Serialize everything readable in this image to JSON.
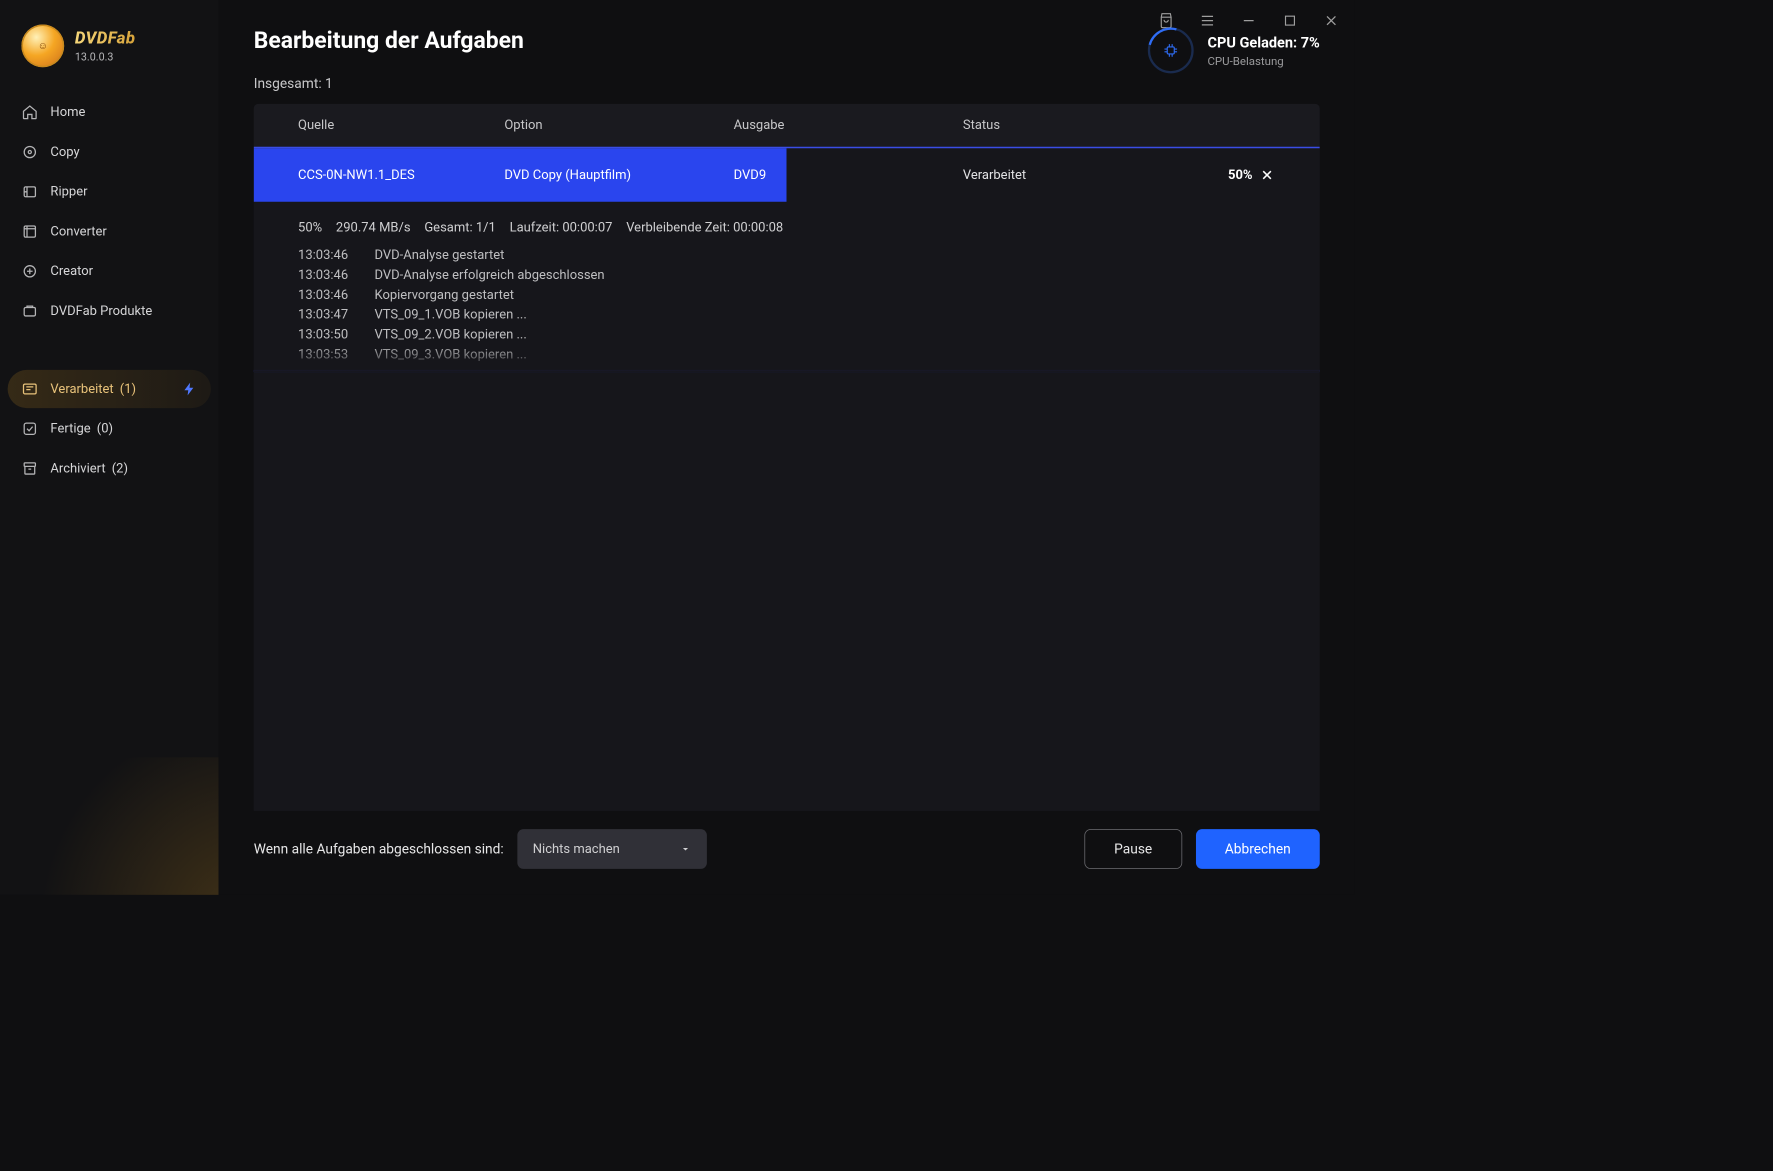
{
  "app": {
    "name": "DVDFab",
    "version": "13.0.0.3"
  },
  "sidebar": {
    "items": [
      {
        "id": "home",
        "label": "Home",
        "icon": "home-icon"
      },
      {
        "id": "copy",
        "label": "Copy",
        "icon": "copy-icon"
      },
      {
        "id": "ripper",
        "label": "Ripper",
        "icon": "ripper-icon"
      },
      {
        "id": "converter",
        "label": "Converter",
        "icon": "converter-icon"
      },
      {
        "id": "creator",
        "label": "Creator",
        "icon": "creator-icon"
      },
      {
        "id": "products",
        "label": "DVDFab Produkte",
        "icon": "products-icon"
      }
    ],
    "queue": [
      {
        "id": "processing",
        "label": "Verarbeitet",
        "count": "(1)",
        "active": true,
        "icon": "queue-icon",
        "bolt": true
      },
      {
        "id": "done",
        "label": "Fertige",
        "count": "(0)",
        "icon": "check-icon"
      },
      {
        "id": "archived",
        "label": "Archiviert",
        "count": "(2)",
        "icon": "archive-icon"
      }
    ]
  },
  "window_controls": {
    "shop": "Shop",
    "menu": "Menu",
    "min": "Minimize",
    "max": "Maximize",
    "close": "Close"
  },
  "header": {
    "title": "Bearbeitung der Aufgaben",
    "total_label": "Insgesamt: 1",
    "cpu_label": "CPU Geladen: 7%",
    "cpu_sub": "CPU-Belastung",
    "cpu_percent": 7
  },
  "columns": {
    "source": "Quelle",
    "option": "Option",
    "output": "Ausgabe",
    "status": "Status"
  },
  "task": {
    "source": "CCS-0N-NW1.1_DES",
    "option": "DVD Copy (Hauptfilm)",
    "output": "DVD9",
    "status": "Verarbeitet",
    "percent_label": "50%"
  },
  "stats": {
    "percent": "50%",
    "speed": "290.74 MB/s",
    "total": "Gesamt: 1/1",
    "runtime": "Laufzeit: 00:00:07",
    "remaining": "Verbleibende Zeit: 00:00:08"
  },
  "log": [
    {
      "time": "13:03:46",
      "msg": "DVD-Analyse gestartet"
    },
    {
      "time": "13:03:46",
      "msg": "DVD-Analyse erfolgreich abgeschlossen"
    },
    {
      "time": "13:03:46",
      "msg": "Kopiervorgang gestartet"
    },
    {
      "time": "13:03:47",
      "msg": "VTS_09_1.VOB kopieren ..."
    },
    {
      "time": "13:03:50",
      "msg": "VTS_09_2.VOB kopieren ..."
    },
    {
      "time": "13:03:53",
      "msg": "VTS_09_3.VOB kopieren ..."
    }
  ],
  "footer": {
    "label": "Wenn alle Aufgaben abgeschlossen sind:",
    "select_value": "Nichts machen",
    "pause": "Pause",
    "cancel": "Abbrechen"
  }
}
